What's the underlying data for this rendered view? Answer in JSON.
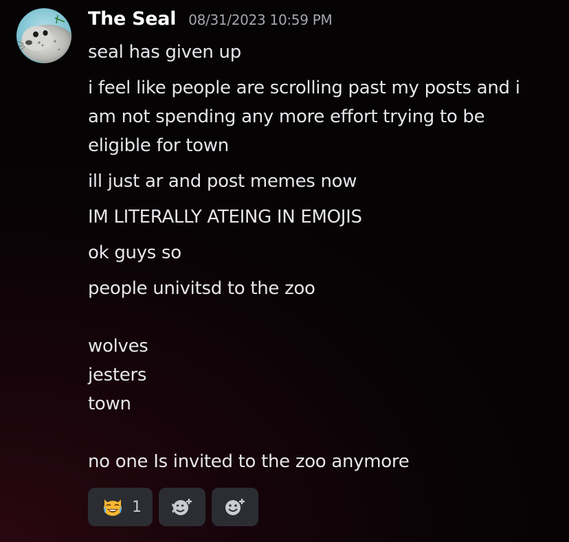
{
  "message": {
    "author": "The Seal",
    "timestamp": "08/31/2023 10:59 PM",
    "avatar_icon": "seal-avatar",
    "paragraphs": [
      {
        "lines": [
          "seal has given up"
        ]
      },
      {
        "lines": [
          "i feel like people are scrolling past my posts and i",
          "am not spending any more effort trying to be",
          "eligible for town"
        ]
      },
      {
        "lines": [
          "ill just ar and post memes now"
        ]
      },
      {
        "lines": [
          "IM LITERALLY ATEING IN EMOJIS"
        ]
      },
      {
        "lines": [
          "ok guys so"
        ]
      },
      {
        "lines": [
          "people univitsd to the zoo",
          "",
          "wolves",
          "jesters",
          "town",
          "",
          "no one Is invited to the zoo anymore"
        ]
      }
    ]
  },
  "reactions": [
    {
      "emoji": "crying-laughing-cat-emoji",
      "count": "1"
    },
    {
      "emoji": "add-super-reaction-icon"
    },
    {
      "emoji": "add-reaction-icon"
    }
  ],
  "colors": {
    "background": "#0a0406",
    "pill": "#2b2d33",
    "username": "#ffffff",
    "timestamp": "#a3a6ad",
    "text": "#e6e6ea"
  }
}
